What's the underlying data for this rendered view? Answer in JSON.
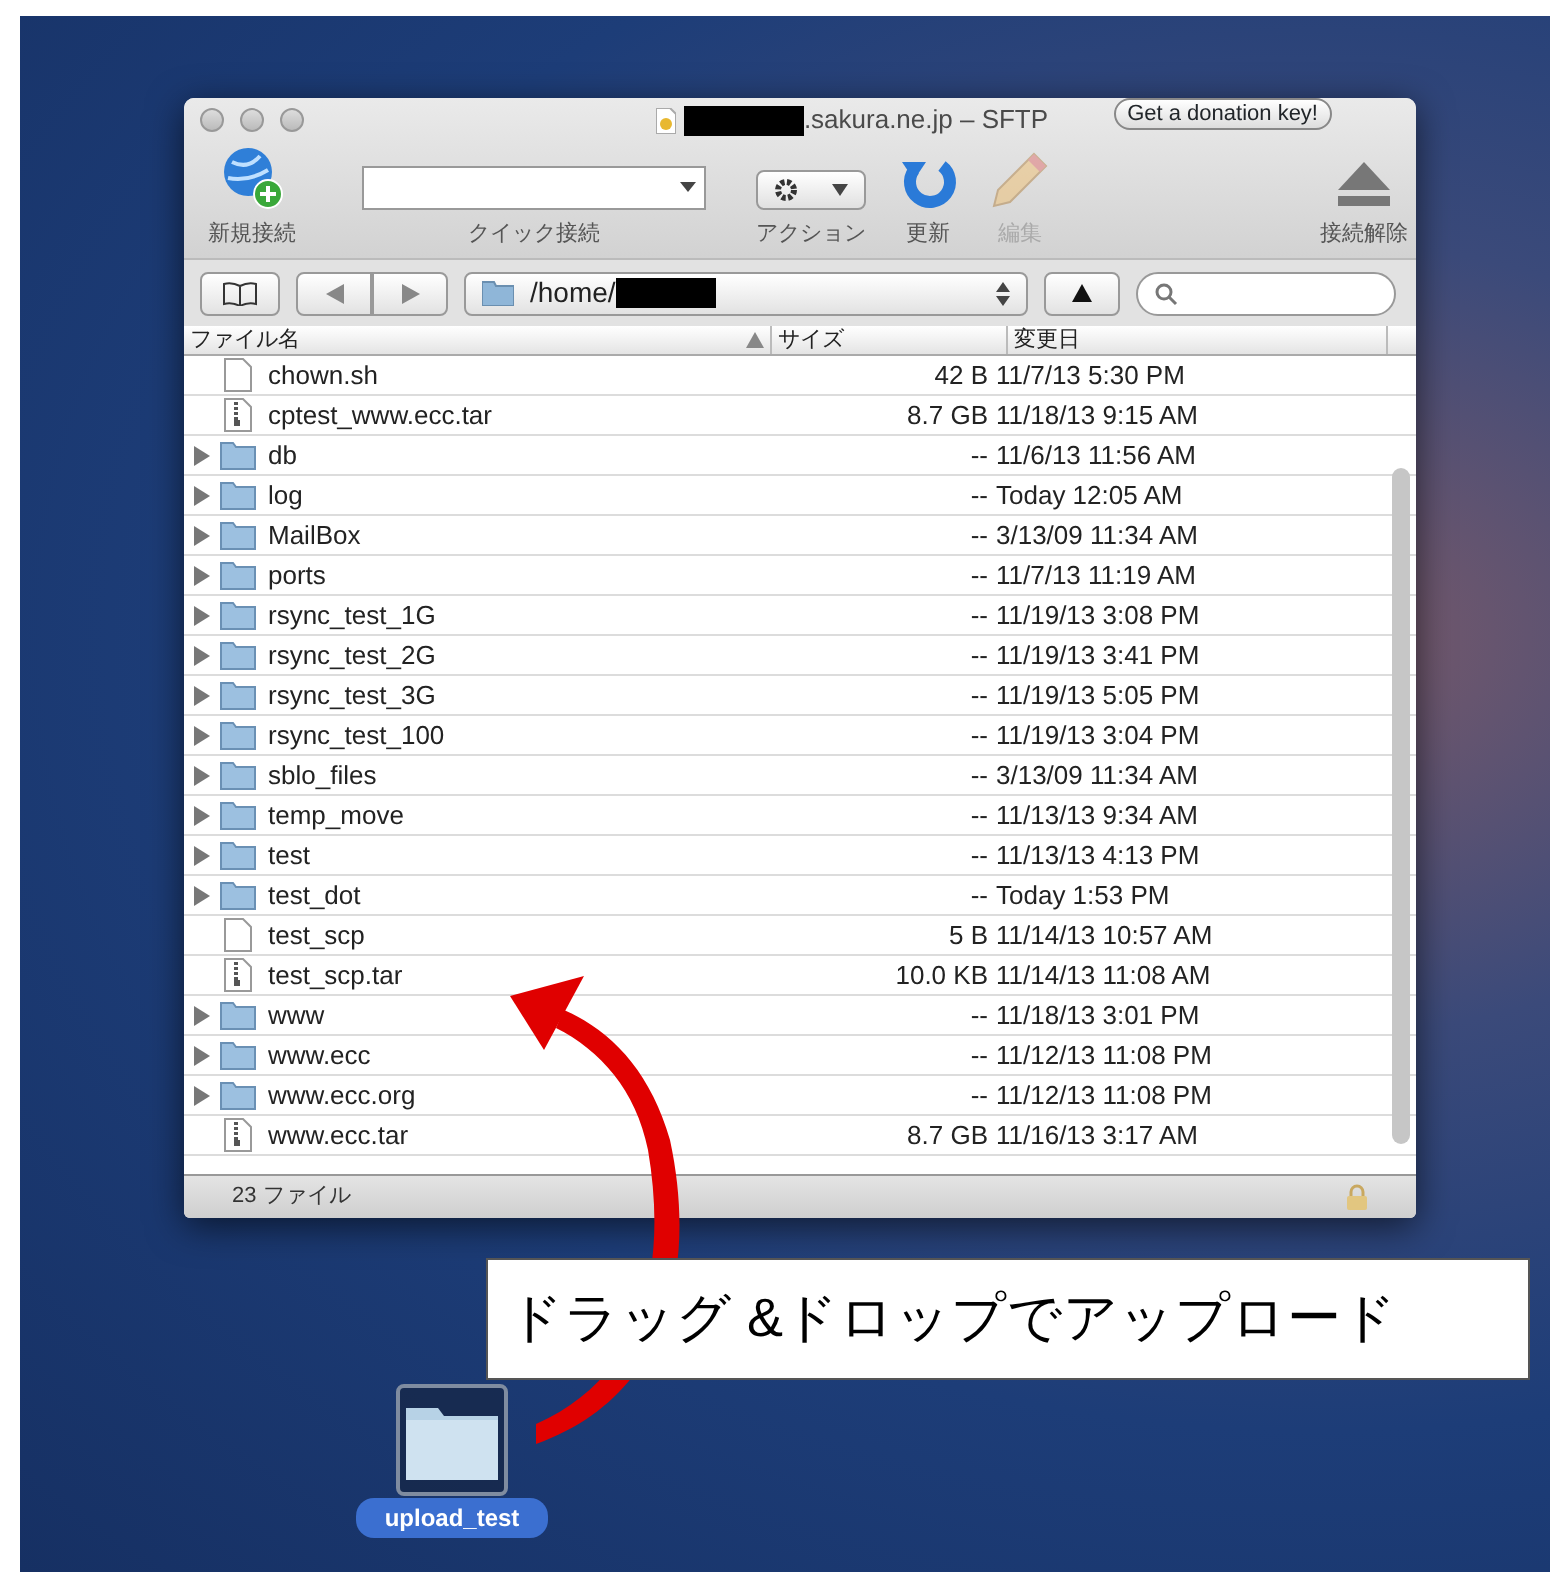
{
  "window": {
    "title": ".sakura.ne.jp – SFTP",
    "donation_button": "Get a donation key!"
  },
  "toolbar": [
    {
      "kind": "new",
      "label": "新規接続",
      "disabled": false
    },
    {
      "kind": "quick",
      "label": "クイック接続",
      "disabled": false
    },
    {
      "kind": "action",
      "label": "アクション",
      "disabled": false
    },
    {
      "kind": "refresh",
      "label": "更新",
      "disabled": false
    },
    {
      "kind": "edit",
      "label": "編集",
      "disabled": true
    },
    {
      "kind": "disconnect",
      "label": "接続解除",
      "disabled": false
    }
  ],
  "path": "/home/",
  "columns": [
    "ファイル名",
    "サイズ",
    "変更日"
  ],
  "rows": [
    {
      "kind": "file",
      "name": "chown.sh",
      "size": "42 B",
      "modified": "11/7/13 5:30 PM"
    },
    {
      "kind": "archive",
      "name": "cptest_www.ecc.tar",
      "size": "8.7 GB",
      "modified": "11/18/13 9:15 AM"
    },
    {
      "kind": "folder",
      "name": "db",
      "size": "--",
      "modified": "11/6/13 11:56 AM"
    },
    {
      "kind": "folder",
      "name": "log",
      "size": "--",
      "modified": "Today 12:05 AM"
    },
    {
      "kind": "folder",
      "name": "MailBox",
      "size": "--",
      "modified": "3/13/09 11:34 AM"
    },
    {
      "kind": "folder",
      "name": "ports",
      "size": "--",
      "modified": "11/7/13 11:19 AM"
    },
    {
      "kind": "folder",
      "name": "rsync_test_1G",
      "size": "--",
      "modified": "11/19/13 3:08 PM"
    },
    {
      "kind": "folder",
      "name": "rsync_test_2G",
      "size": "--",
      "modified": "11/19/13 3:41 PM"
    },
    {
      "kind": "folder",
      "name": "rsync_test_3G",
      "size": "--",
      "modified": "11/19/13 5:05 PM"
    },
    {
      "kind": "folder",
      "name": "rsync_test_100",
      "size": "--",
      "modified": "11/19/13 3:04 PM"
    },
    {
      "kind": "folder",
      "name": "sblo_files",
      "size": "--",
      "modified": "3/13/09 11:34 AM"
    },
    {
      "kind": "folder",
      "name": "temp_move",
      "size": "--",
      "modified": "11/13/13 9:34 AM"
    },
    {
      "kind": "folder",
      "name": "test",
      "size": "--",
      "modified": "11/13/13 4:13 PM"
    },
    {
      "kind": "folder",
      "name": "test_dot",
      "size": "--",
      "modified": "Today 1:53 PM"
    },
    {
      "kind": "file",
      "name": "test_scp",
      "size": "5 B",
      "modified": "11/14/13 10:57 AM"
    },
    {
      "kind": "archive",
      "name": "test_scp.tar",
      "size": "10.0 KB",
      "modified": "11/14/13 11:08 AM"
    },
    {
      "kind": "folder",
      "name": "www",
      "size": "--",
      "modified": "11/18/13 3:01 PM"
    },
    {
      "kind": "folder",
      "name": "www.ecc",
      "size": "--",
      "modified": "11/12/13 11:08 PM"
    },
    {
      "kind": "folder",
      "name": "www.ecc.org",
      "size": "--",
      "modified": "11/12/13 11:08 PM"
    },
    {
      "kind": "archive",
      "name": "www.ecc.tar",
      "size": "8.7 GB",
      "modified": "11/16/13 3:17 AM"
    }
  ],
  "status_bar": "23 ファイル",
  "callout": "ドラッグ &ドロップでアップロード",
  "desktop_icon": {
    "label": "upload_test",
    "selected": true
  }
}
